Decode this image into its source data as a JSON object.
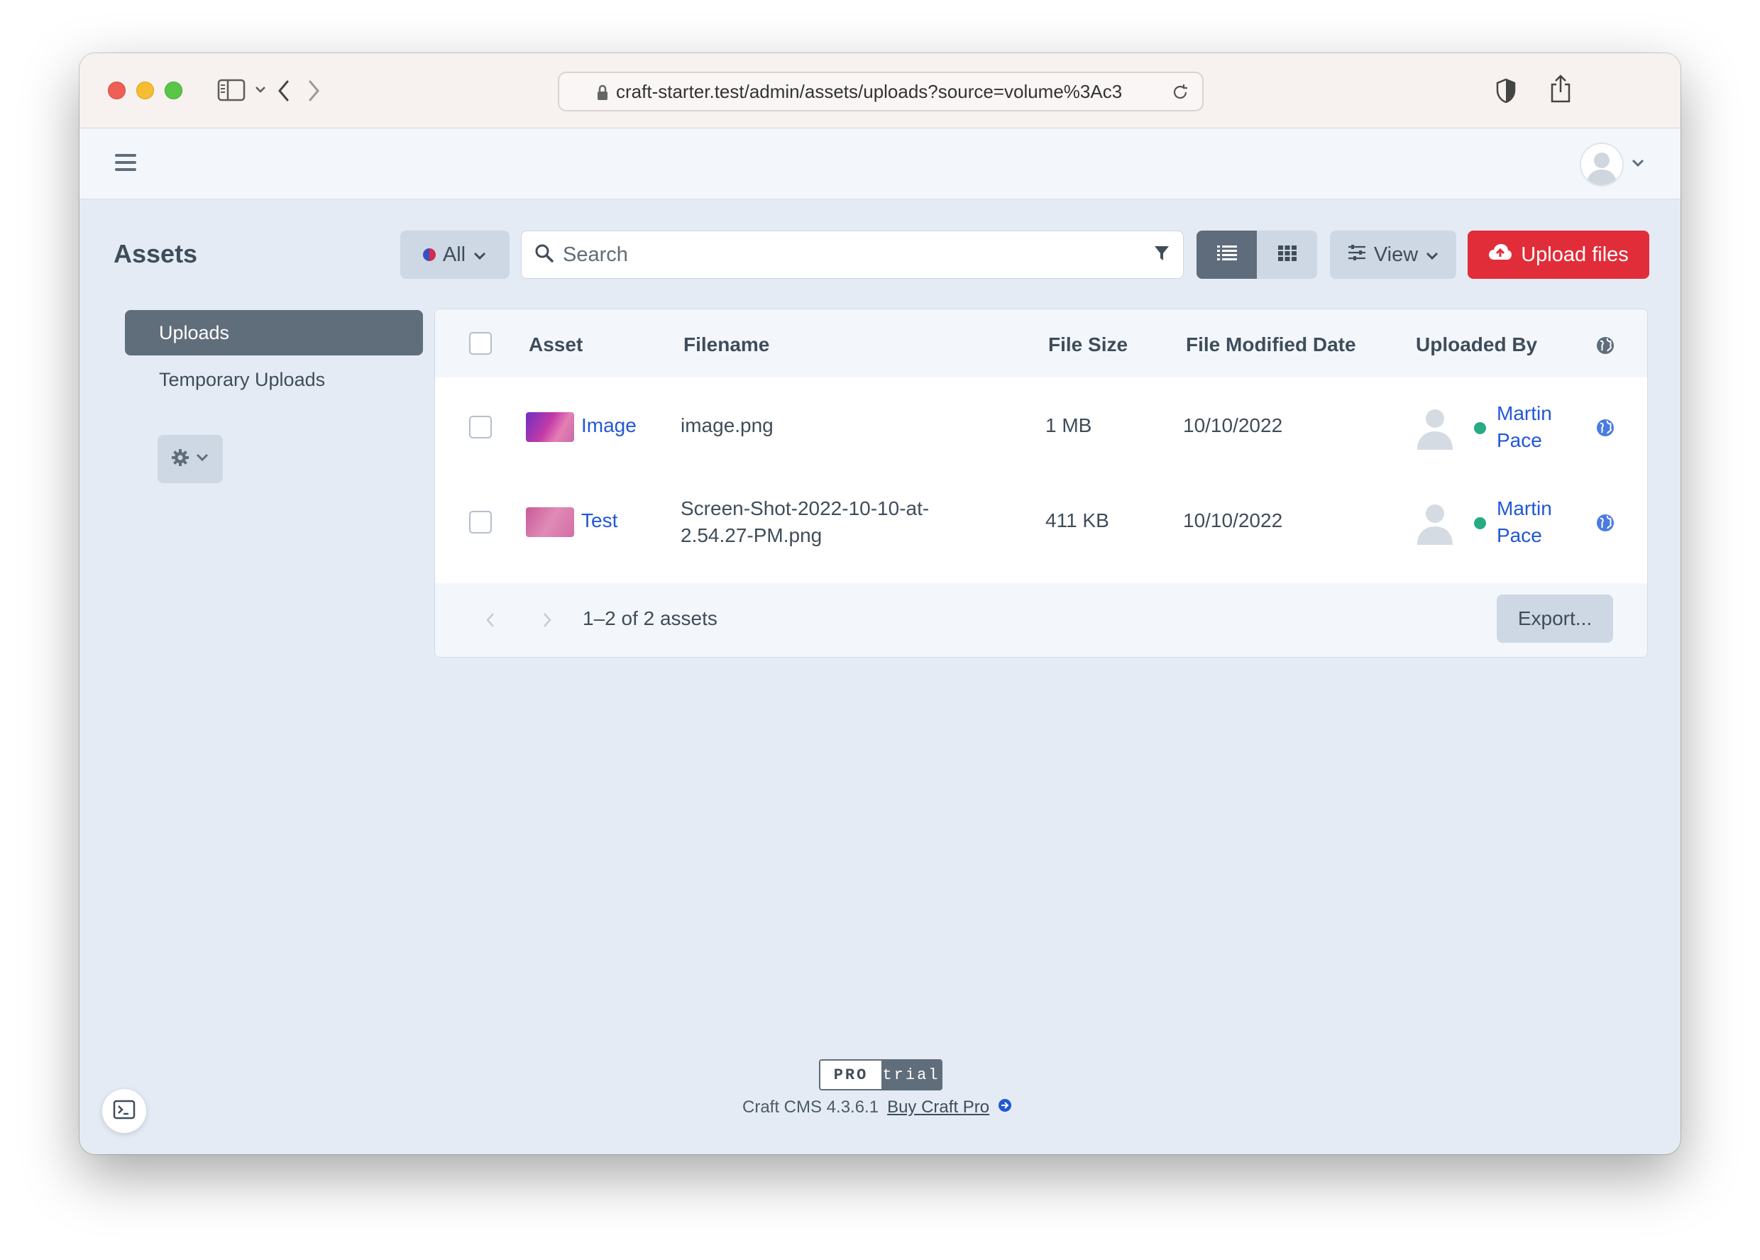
{
  "browser": {
    "url": "craft-starter.test/admin/assets/uploads?source=volume%3Ac3"
  },
  "page": {
    "title": "Assets"
  },
  "toolbar": {
    "site_label": "All",
    "search_placeholder": "Search",
    "view_label": "View",
    "upload_label": "Upload files"
  },
  "sidebar": {
    "items": [
      {
        "label": "Uploads",
        "active": true
      },
      {
        "label": "Temporary Uploads",
        "active": false
      }
    ]
  },
  "table": {
    "headers": {
      "asset": "Asset",
      "filename": "Filename",
      "file_size": "File Size",
      "modified": "File Modified Date",
      "uploaded_by": "Uploaded By"
    },
    "rows": [
      {
        "title": "Image",
        "filename": "image.png",
        "filename_line2": "",
        "size": "1 MB",
        "date": "10/10/2022",
        "user_first": "Martin",
        "user_last": "Pace"
      },
      {
        "title": "Test",
        "filename": "Screen-Shot-2022-10-10-at-",
        "filename_line2": "2.54.27-PM.png",
        "size": "411 KB",
        "date": "10/10/2022",
        "user_first": "Martin",
        "user_last": "Pace"
      }
    ],
    "pagination": "1–2 of 2 assets",
    "export_label": "Export..."
  },
  "footer": {
    "edition_pro": "PRO",
    "edition_trial": "trial",
    "version": "Craft CMS 4.3.6.1",
    "buy_link": "Buy Craft Pro"
  },
  "colors": {
    "accent_red": "#e12d39",
    "link_blue": "#2257d6",
    "sidebar_active": "#606d7b",
    "status_green": "#27ab83"
  },
  "icons": [
    "sidebar-toggle-icon",
    "chevron-down-icon",
    "back-icon",
    "forward-icon",
    "lock-icon",
    "reload-icon",
    "shield-icon",
    "share-icon",
    "hamburger-icon",
    "user-icon",
    "search-icon",
    "filter-icon",
    "list-view-icon",
    "grid-view-icon",
    "sliders-icon",
    "cloud-upload-icon",
    "gear-icon",
    "globe-icon",
    "terminal-icon",
    "arrow-circle-right-icon"
  ]
}
